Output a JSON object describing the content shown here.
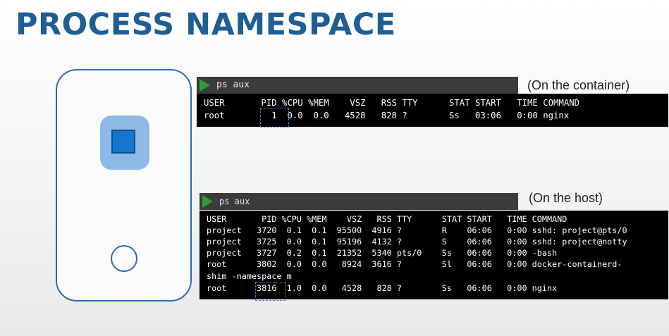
{
  "title": "PROCESS NAMESPACE",
  "container_terminal": {
    "command": "ps aux",
    "caption": "(On the container)",
    "lines": [
      "USER       PID %CPU %MEM    VSZ   RSS TTY      STAT START   TIME COMMAND",
      "root         1  0.0  0.0   4528   828 ?        Ss   03:06   0:00 nginx"
    ],
    "highlight_value": "1"
  },
  "host_terminal": {
    "command": "ps aux",
    "caption": "(On the host)",
    "lines": [
      "USER       PID %CPU %MEM    VSZ   RSS TTY      STAT START   TIME COMMAND",
      "project   3720  0.1  0.1  95500  4916 ?        R    06:06   0:00 sshd: project@pts/0",
      "project   3725  0.0  0.1  95196  4132 ?        S    06:06   0:00 sshd: project@notty",
      "project   3727  0.2  0.1  21352  5340 pts/0    Ss   06:06   0:00 -bash",
      "root      3802  0.0  0.0   8924  3616 ?        Sl   06:06   0:00 docker-containerd-",
      "shim -namespace m",
      "root      3816  1.0  0.0   4528   828 ?        Ss   06:06   0:00 nginx"
    ],
    "highlight_value": "3816"
  },
  "colors": {
    "title": "#1f5d95",
    "phone_border": "#2a6cb0",
    "container_outer": "#8cb9e6",
    "container_inner": "#1675cc",
    "play_icon": "#2ca22c",
    "terminal_bg": "#000000",
    "terminal_bar": "#3b3b3b"
  },
  "icons": [
    "phone-outline",
    "container-square-icon",
    "home-button-circle",
    "play-icon"
  ]
}
